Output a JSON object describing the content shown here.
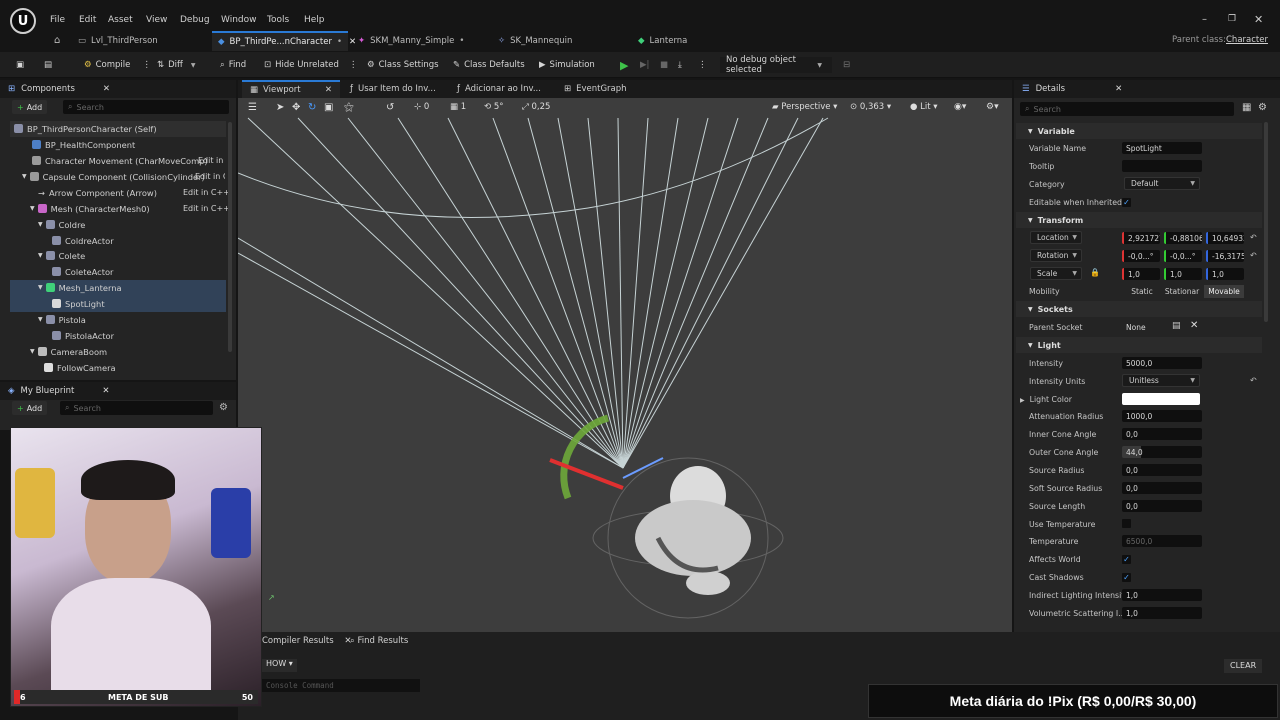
{
  "menu": [
    "File",
    "Edit",
    "Asset",
    "View",
    "Debug",
    "Window",
    "Tools",
    "Help"
  ],
  "tabs": [
    {
      "label": "Lvl_ThirdPerson",
      "active": false
    },
    {
      "label": "BP_ThirdPe...nCharacter",
      "active": true
    },
    {
      "label": "SKM_Manny_Simple",
      "active": false
    },
    {
      "label": "SK_Mannequin",
      "active": false
    },
    {
      "label": "Lanterna",
      "active": false
    }
  ],
  "parent_class": {
    "label": "Parent class:",
    "value": "Character"
  },
  "toolbar": {
    "compile": "Compile",
    "diff": "Diff",
    "find": "Find",
    "hide_unrelated": "Hide Unrelated",
    "class_settings": "Class Settings",
    "class_defaults": "Class Defaults",
    "simulation": "Simulation",
    "debug_object": "No debug object selected"
  },
  "components": {
    "title": "Components",
    "add": "Add",
    "search_placeholder": "Search",
    "items": [
      {
        "label": "BP_ThirdPersonCharacter (Self)",
        "edit": ""
      },
      {
        "label": "BP_HealthComponent",
        "edit": ""
      },
      {
        "label": "Character Movement (CharMoveComp)",
        "edit": "Edit in C"
      },
      {
        "label": "Capsule Component (CollisionCylinder)",
        "edit": "Edit in C"
      },
      {
        "label": "Arrow Component (Arrow)",
        "edit": "Edit in C++"
      },
      {
        "label": "Mesh (CharacterMesh0)",
        "edit": "Edit in C++"
      },
      {
        "label": "Coldre",
        "edit": ""
      },
      {
        "label": "ColdreActor",
        "edit": ""
      },
      {
        "label": "Colete",
        "edit": ""
      },
      {
        "label": "ColeteActor",
        "edit": ""
      },
      {
        "label": "Mesh_Lanterna",
        "edit": ""
      },
      {
        "label": "SpotLight",
        "edit": ""
      },
      {
        "label": "Pistola",
        "edit": ""
      },
      {
        "label": "PistolaActor",
        "edit": ""
      },
      {
        "label": "CameraBoom",
        "edit": ""
      },
      {
        "label": "FollowCamera",
        "edit": ""
      }
    ]
  },
  "my_blueprint": {
    "title": "My Blueprint",
    "add": "Add",
    "search_placeholder": "Search"
  },
  "editor_tabs": [
    "Viewport",
    "Usar Item do Inv...",
    "Adicionar ao Inv...",
    "EventGraph"
  ],
  "viewport": {
    "perspective": "Perspective",
    "lit": "Lit",
    "fov_value": "0,363",
    "grid_snap": "0",
    "rot_snap": "5°",
    "scale_snap": "0,25",
    "cam_speed": "1"
  },
  "bottom": {
    "compiler_results": "Compiler Results",
    "find_results": "Find Results",
    "show": "HOW",
    "console_placeholder": "Console Command",
    "clear": "CLEAR"
  },
  "details": {
    "title": "Details",
    "search_placeholder": "Search",
    "sections": {
      "variable": "Variable",
      "transform": "Transform",
      "sockets": "Sockets",
      "light": "Light"
    },
    "variable_name": {
      "label": "Variable Name",
      "value": "SpotLight"
    },
    "tooltip": {
      "label": "Tooltip",
      "value": ""
    },
    "category": {
      "label": "Category",
      "value": "Default"
    },
    "editable": {
      "label": "Editable when Inherited",
      "checked": true
    },
    "location": {
      "label": "Location",
      "x": "2,921727",
      "y": "-0,88106;",
      "z": "10,64933"
    },
    "rotation": {
      "label": "Rotation",
      "x": "-0,0...°",
      "y": "-0,0...°",
      "z": "-16,3175"
    },
    "scale": {
      "label": "Scale",
      "x": "1,0",
      "y": "1,0",
      "z": "1,0"
    },
    "mobility": {
      "label": "Mobility",
      "options": [
        "Static",
        "Stationar",
        "Movable"
      ],
      "selected": "Movable"
    },
    "parent_socket": {
      "label": "Parent Socket",
      "value": "None"
    },
    "intensity": {
      "label": "Intensity",
      "value": "5000,0"
    },
    "intensity_units": {
      "label": "Intensity Units",
      "value": "Unitless"
    },
    "light_color": {
      "label": "Light Color",
      "value": "#ffffff"
    },
    "attenuation": {
      "label": "Attenuation Radius",
      "value": "1000,0"
    },
    "inner_cone": {
      "label": "Inner Cone Angle",
      "value": "0,0"
    },
    "outer_cone": {
      "label": "Outer Cone Angle",
      "value": "44,0"
    },
    "source_radius": {
      "label": "Source Radius",
      "value": "0,0"
    },
    "soft_source_radius": {
      "label": "Soft Source Radius",
      "value": "0,0"
    },
    "source_length": {
      "label": "Source Length",
      "value": "0,0"
    },
    "use_temperature": {
      "label": "Use Temperature",
      "checked": false
    },
    "temperature": {
      "label": "Temperature",
      "value": "6500,0"
    },
    "affects_world": {
      "label": "Affects World",
      "checked": true
    },
    "cast_shadows": {
      "label": "Cast Shadows",
      "checked": true
    },
    "indirect": {
      "label": "Indirect Lighting Intensity",
      "value": "1,0"
    },
    "volumetric": {
      "label": "Volumetric Scattering I...",
      "value": "1,0"
    }
  },
  "stream": {
    "goal_label": "META DE SUB",
    "goal_current": "6",
    "goal_target": "50",
    "pix_banner": "Meta diária do !Pix (R$ 0,00/R$ 30,00)"
  }
}
